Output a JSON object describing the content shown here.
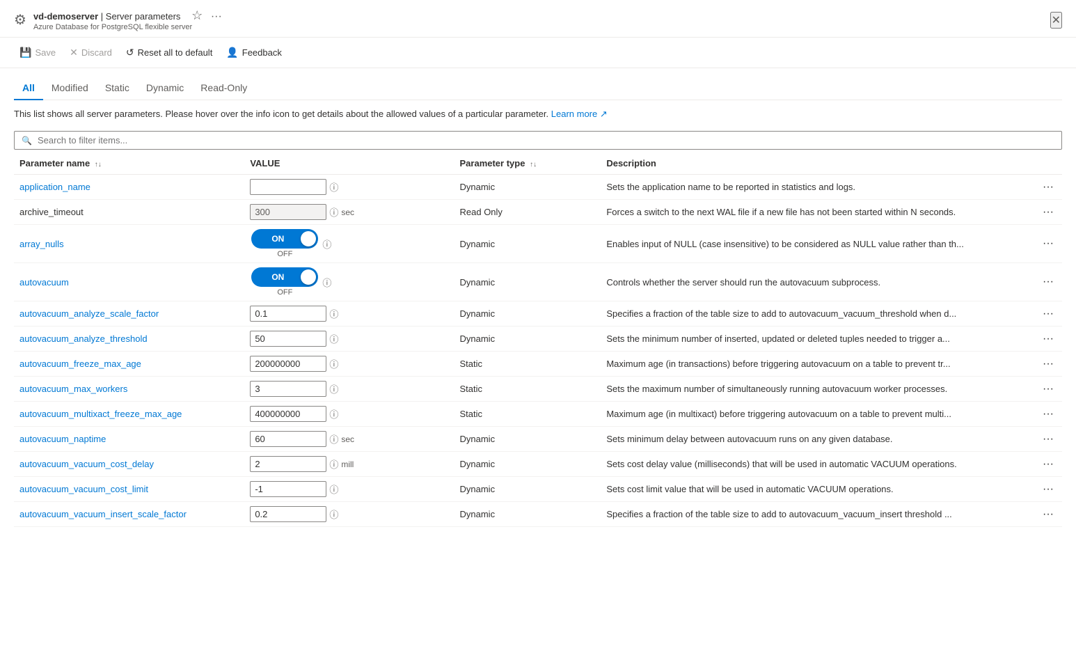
{
  "header": {
    "icon": "⚙",
    "server_name": "vd-demoserver",
    "separator": "|",
    "page_title": "Server parameters",
    "subtitle": "Azure Database for PostgreSQL flexible server",
    "star_icon": "☆",
    "ellipsis_icon": "···",
    "close_icon": "✕"
  },
  "toolbar": {
    "save_label": "Save",
    "discard_label": "Discard",
    "reset_label": "Reset all to default",
    "feedback_label": "Feedback",
    "save_icon": "💾",
    "discard_icon": "✕",
    "reset_icon": "↺",
    "feedback_icon": "👤"
  },
  "tabs": [
    {
      "id": "all",
      "label": "All",
      "active": true
    },
    {
      "id": "modified",
      "label": "Modified",
      "active": false
    },
    {
      "id": "static",
      "label": "Static",
      "active": false
    },
    {
      "id": "dynamic",
      "label": "Dynamic",
      "active": false
    },
    {
      "id": "readonly",
      "label": "Read-Only",
      "active": false
    }
  ],
  "description": "This list shows all server parameters. Please hover over the info icon to get details about the allowed values of a particular parameter.",
  "learn_more": "Learn more",
  "search": {
    "placeholder": "Search to filter items..."
  },
  "table": {
    "columns": [
      {
        "id": "param",
        "label": "Parameter name",
        "sortable": true
      },
      {
        "id": "value",
        "label": "VALUE",
        "sortable": false
      },
      {
        "id": "type",
        "label": "Parameter type",
        "sortable": true
      },
      {
        "id": "desc",
        "label": "Description",
        "sortable": false
      }
    ],
    "rows": [
      {
        "param": "application_name",
        "is_link": true,
        "value_type": "text",
        "value": "",
        "value_placeholder": "",
        "unit": "",
        "param_type": "Dynamic",
        "description": "Sets the application name to be reported in statistics and logs."
      },
      {
        "param": "archive_timeout",
        "is_link": false,
        "value_type": "text",
        "value": "300",
        "value_placeholder": "300",
        "value_disabled": true,
        "unit": "sec",
        "param_type": "Read Only",
        "description": "Forces a switch to the next WAL file if a new file has not been started within N seconds."
      },
      {
        "param": "array_nulls",
        "is_link": true,
        "value_type": "toggle",
        "toggle_state": "on",
        "unit": "",
        "param_type": "Dynamic",
        "description": "Enables input of NULL (case insensitive) to be considered as NULL value rather than th..."
      },
      {
        "param": "autovacuum",
        "is_link": true,
        "value_type": "toggle",
        "toggle_state": "on",
        "unit": "",
        "param_type": "Dynamic",
        "description": "Controls whether the server should run the autovacuum subprocess."
      },
      {
        "param": "autovacuum_analyze_scale_factor",
        "is_link": true,
        "value_type": "text",
        "value": "0.1",
        "unit": "",
        "param_type": "Dynamic",
        "description": "Specifies a fraction of the table size to add to autovacuum_vacuum_threshold when d..."
      },
      {
        "param": "autovacuum_analyze_threshold",
        "is_link": true,
        "value_type": "text",
        "value": "50",
        "unit": "",
        "param_type": "Dynamic",
        "description": "Sets the minimum number of inserted, updated or deleted tuples needed to trigger a..."
      },
      {
        "param": "autovacuum_freeze_max_age",
        "is_link": true,
        "value_type": "text",
        "value": "200000000",
        "unit": "",
        "param_type": "Static",
        "description": "Maximum age (in transactions) before triggering autovacuum on a table to prevent tr..."
      },
      {
        "param": "autovacuum_max_workers",
        "is_link": true,
        "value_type": "text",
        "value": "3",
        "unit": "",
        "param_type": "Static",
        "description": "Sets the maximum number of simultaneously running autovacuum worker processes."
      },
      {
        "param": "autovacuum_multixact_freeze_max_age",
        "is_link": true,
        "value_type": "text",
        "value": "400000000",
        "unit": "",
        "param_type": "Static",
        "description": "Maximum age (in multixact) before triggering autovacuum on a table to prevent multi..."
      },
      {
        "param": "autovacuum_naptime",
        "is_link": true,
        "value_type": "text",
        "value": "60",
        "unit": "sec",
        "param_type": "Dynamic",
        "description": "Sets minimum delay between autovacuum runs on any given database."
      },
      {
        "param": "autovacuum_vacuum_cost_delay",
        "is_link": true,
        "value_type": "text",
        "value": "2",
        "unit": "mill",
        "param_type": "Dynamic",
        "description": "Sets cost delay value (milliseconds) that will be used in automatic VACUUM operations."
      },
      {
        "param": "autovacuum_vacuum_cost_limit",
        "is_link": true,
        "value_type": "text",
        "value": "-1",
        "unit": "",
        "param_type": "Dynamic",
        "description": "Sets cost limit value that will be used in automatic VACUUM operations."
      },
      {
        "param": "autovacuum_vacuum_insert_scale_factor",
        "is_link": true,
        "value_type": "text",
        "value": "0.2",
        "unit": "",
        "param_type": "Dynamic",
        "description": "Specifies a fraction of the table size to add to autovacuum_vacuum_insert threshold ..."
      }
    ]
  }
}
